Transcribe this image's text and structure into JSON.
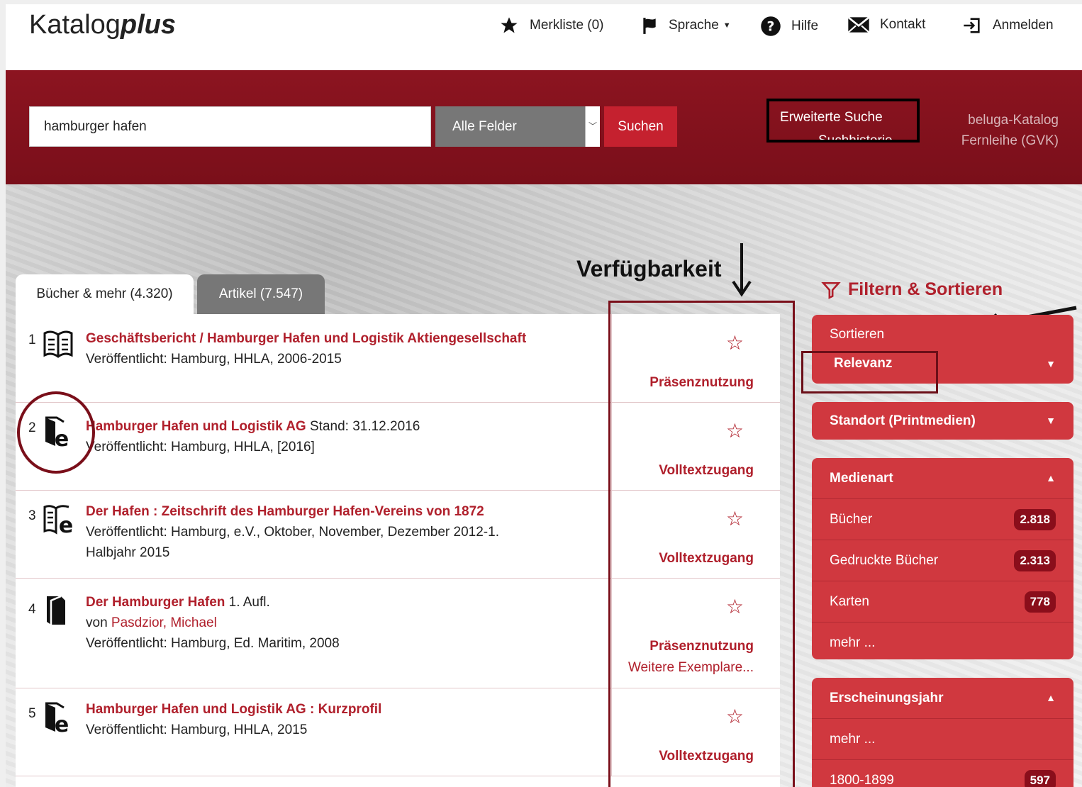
{
  "app": {
    "logo_main": "Katalog",
    "logo_bold": "plus"
  },
  "nav": {
    "merkliste": "Merkliste (0)",
    "sprache": "Sprache",
    "hilfe": "Hilfe",
    "kontakt": "Kontakt",
    "anmelden": "Anmelden"
  },
  "search": {
    "value": "hamburger hafen",
    "field": "Alle Felder",
    "button": "Suchen",
    "advanced": "Erweiterte Suche",
    "history": "Suchhistorie",
    "beluga": "beluga-Katalog",
    "fernleihe": "Fernleihe (GVK)"
  },
  "tabs": [
    {
      "label": "Bücher & mehr (4.320)"
    },
    {
      "label": "Artikel (7.547)"
    }
  ],
  "annotation": {
    "verfuegbarkeit": "Verfügbarkeit"
  },
  "results": [
    {
      "num": "1",
      "icon": "book-icon",
      "title": "Geschäftsbericht / Hamburger Hafen und Logistik Aktiengesellschaft",
      "suffix": "",
      "line2": "Veröffentlicht: Hamburg, HHLA, 2006-2015",
      "line3": "",
      "status": "Präsenznutzung",
      "more": ""
    },
    {
      "num": "2",
      "icon": "ebook-icon",
      "title": "Hamburger Hafen und Logistik AG",
      "suffix": " Stand: 31.12.2016",
      "line2": "Veröffentlicht: Hamburg, HHLA, [2016]",
      "line3": "",
      "status": "Volltextzugang",
      "more": ""
    },
    {
      "num": "3",
      "icon": "ejournal-icon",
      "title": "Der Hafen : Zeitschrift des Hamburger Hafen-Vereins von 1872",
      "suffix": "",
      "line2": "Veröffentlicht: Hamburg, e.V., Oktober, November, Dezember 2012-1.",
      "line3": "Halbjahr 2015",
      "status": "Volltextzugang",
      "more": ""
    },
    {
      "num": "4",
      "icon": "printed-book-icon",
      "title": "Der Hamburger Hafen",
      "suffix": " 1. Aufl.",
      "author_prefix": "von ",
      "author": "Pasdzior, Michael",
      "line2": "Veröffentlicht: Hamburg, Ed. Maritim, 2008",
      "line3": "",
      "status": "Präsenznutzung",
      "more": "Weitere Exemplare..."
    },
    {
      "num": "5",
      "icon": "ebook-icon",
      "title": "Hamburger Hafen und Logistik AG : Kurzprofil",
      "suffix": "",
      "line2": "Veröffentlicht: Hamburg, HHLA, 2015",
      "line3": "",
      "status": "Volltextzugang",
      "more": ""
    }
  ],
  "facets": {
    "header": "Filtern & Sortieren",
    "sort": {
      "label": "Sortieren",
      "value": "Relevanz"
    },
    "standort": "Standort (Printmedien)",
    "medienart": {
      "title": "Medienart",
      "items": [
        {
          "label": "Bücher",
          "count": "2.818"
        },
        {
          "label": "Gedruckte Bücher",
          "count": "2.313"
        },
        {
          "label": "Karten",
          "count": "778"
        }
      ],
      "more": "mehr ..."
    },
    "jahr": {
      "title": "Erscheinungsjahr",
      "more": "mehr ...",
      "items": [
        {
          "label": "1800-1899",
          "count": "597"
        }
      ]
    }
  }
}
